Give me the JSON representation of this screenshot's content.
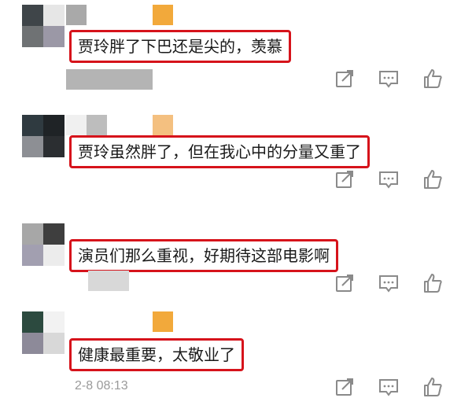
{
  "comments": [
    {
      "text": "贾玲胖了下巴还是尖的，羡慕",
      "time": ""
    },
    {
      "text": "贾玲虽然胖了，但在我心中的分量又重了",
      "time": ""
    },
    {
      "text": "演员们那么重视，好期待这部电影啊",
      "time": ""
    },
    {
      "text": "健康最重要，太敬业了",
      "time": "2-8 08:13"
    }
  ],
  "actions": [
    {
      "icon": "share-icon"
    },
    {
      "icon": "comment-icon"
    },
    {
      "icon": "like-icon"
    }
  ],
  "colors": {
    "highlight_border": "#d6131b",
    "avatar_accent": "#f2a93b",
    "icon_color": "#8a8a8a"
  }
}
